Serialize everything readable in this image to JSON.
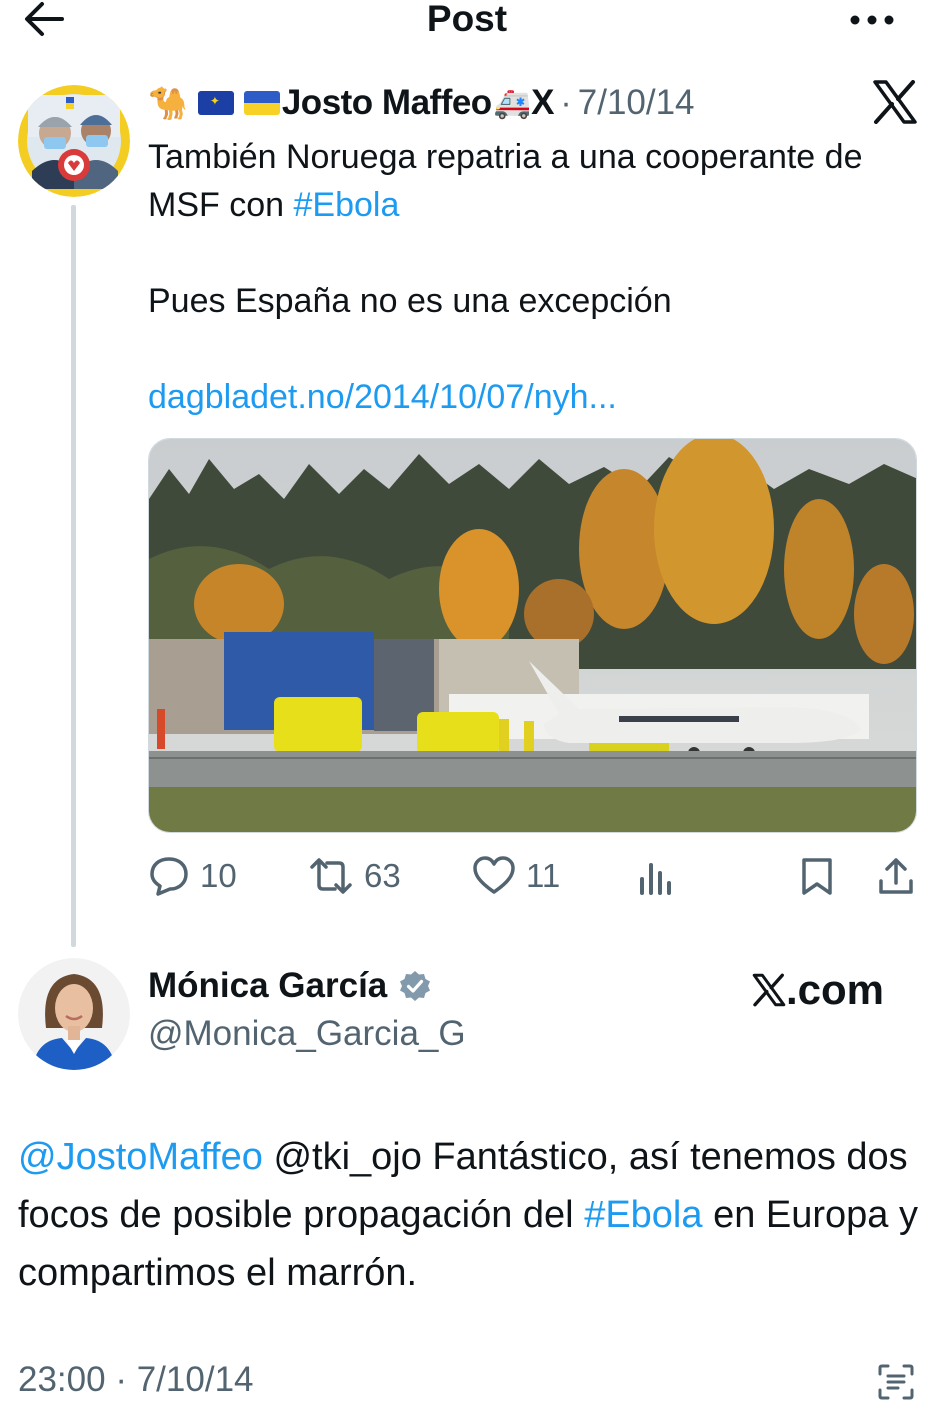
{
  "header": {
    "title": "Post",
    "back_icon": "arrow-left-icon",
    "more_icon": "more-horizontal-icon"
  },
  "tweet1": {
    "author_prefix_emoji": "🐪",
    "author_name": "Josto Maffeo",
    "author_suffix_emoji": "🚑",
    "author_suffix_text": "X",
    "separator": "·",
    "date": "7/10/14",
    "text_line1": "También Noruega repatria a una cooperante de MSF con ",
    "hashtag": "#Ebola",
    "text_line2": "Pues España no es una excepción",
    "link": "dagbladet.no/2014/10/07/nyh...",
    "replies": "10",
    "retweets": "63",
    "likes": "11"
  },
  "tweet2": {
    "author_name": "Mónica García",
    "handle": "@Monica_Garcia_G",
    "brand": ".com",
    "mention1": "@JostoMaffeo",
    "text_a": " @tki_ojo Fantástico, así tenemos dos focos de posible propagación del ",
    "hashtag": "#Ebola",
    "text_b": " en Europa y compartimos el marrón.",
    "time": "23:00",
    "separator": "·",
    "date": "7/10/14"
  },
  "colors": {
    "link": "#1d9bf0",
    "secondary_text": "#536471",
    "verified_badge": "#829aab",
    "thread_line": "#cfd9de"
  }
}
